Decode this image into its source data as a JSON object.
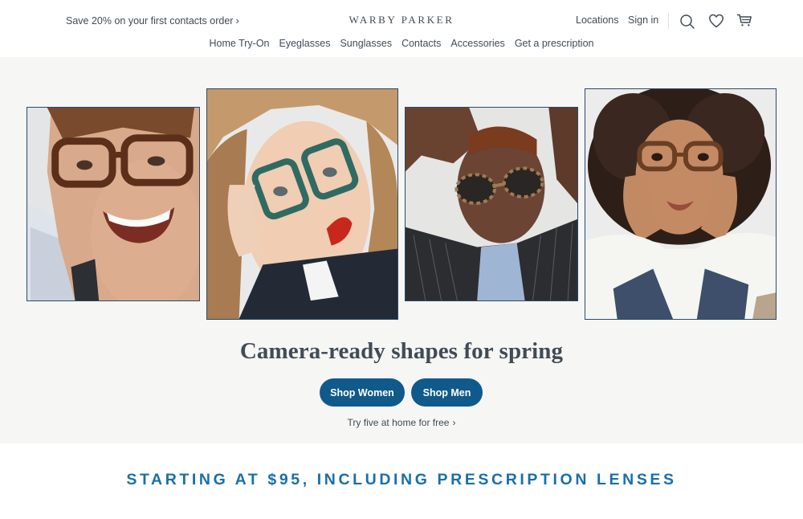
{
  "header": {
    "promo": "Save 20% on your first contacts order",
    "promo_chevron": "›",
    "logo": "WARBY PARKER",
    "locations": "Locations",
    "sign_in": "Sign in",
    "icons": [
      "search-icon",
      "heart-icon",
      "cart-icon"
    ]
  },
  "nav": {
    "items": [
      {
        "label": "Home Try-On"
      },
      {
        "label": "Eyeglasses"
      },
      {
        "label": "Sunglasses"
      },
      {
        "label": "Contacts"
      },
      {
        "label": "Accessories"
      },
      {
        "label": "Get a prescription"
      }
    ]
  },
  "hero": {
    "headline": "Camera-ready shapes for spring",
    "shop_women": "Shop Women",
    "shop_men": "Shop Men",
    "try_five": "Try five at home for free",
    "try_five_chevron": "›"
  },
  "banner": {
    "text": "STARTING AT $95, INCLUDING PRESCRIPTION LENSES"
  },
  "colors": {
    "primary_button": "#0f5a8a",
    "banner_text": "#1a6fa8",
    "hero_background": "#f6f6f5",
    "text": "#414b56",
    "photo_border": "#2b4a6b"
  }
}
